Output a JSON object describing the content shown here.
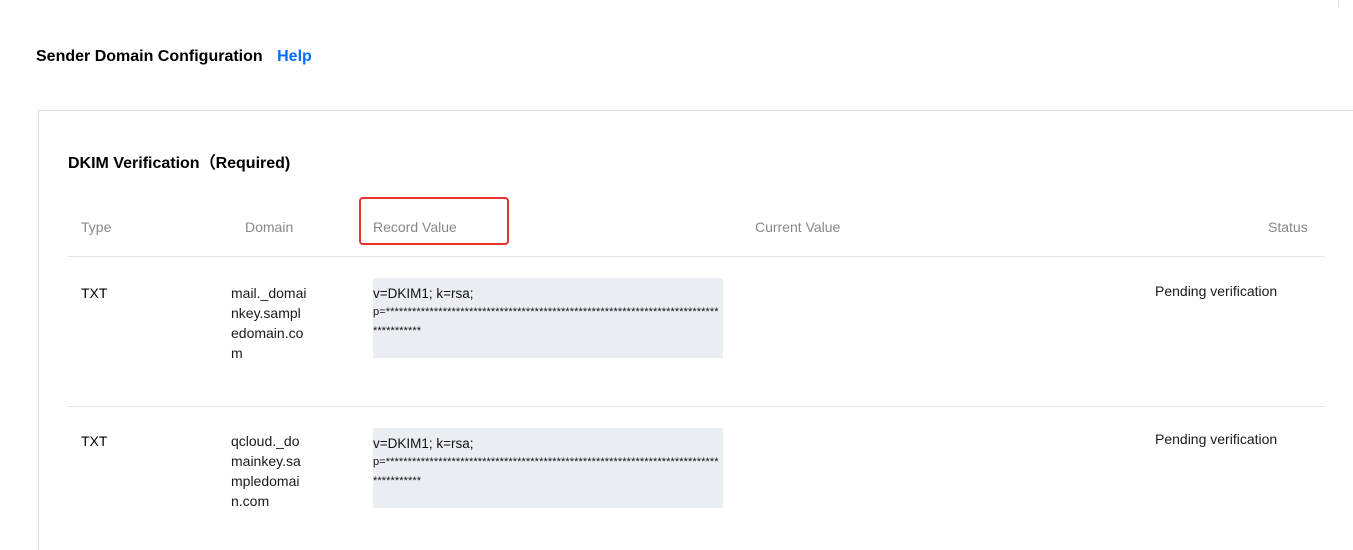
{
  "header": {
    "title": "Sender Domain Configuration",
    "help_link": "Help"
  },
  "dkim": {
    "title": "DKIM Verification（Required)",
    "columns": {
      "type": "Type",
      "domain": "Domain",
      "record_value": "Record Value",
      "current_value": "Current Value",
      "status": "Status"
    },
    "rows": [
      {
        "type": "TXT",
        "domain": "mail._domainkey.sampledomain.com",
        "record_line1": "v=DKIM1; k=rsa;",
        "record_line2": "p=***************************************************************************************",
        "current_value": "",
        "status": "Pending verification"
      },
      {
        "type": "TXT",
        "domain": "qcloud._domainkey.sampledomain.com",
        "record_line1": "v=DKIM1; k=rsa;",
        "record_line2": "p=***************************************************************************************",
        "current_value": "",
        "status": "Pending verification"
      }
    ]
  },
  "colors": {
    "link": "#006eff",
    "highlight_border": "#e5322d",
    "record_background": "#eaedf2",
    "header_text": "#888888"
  }
}
